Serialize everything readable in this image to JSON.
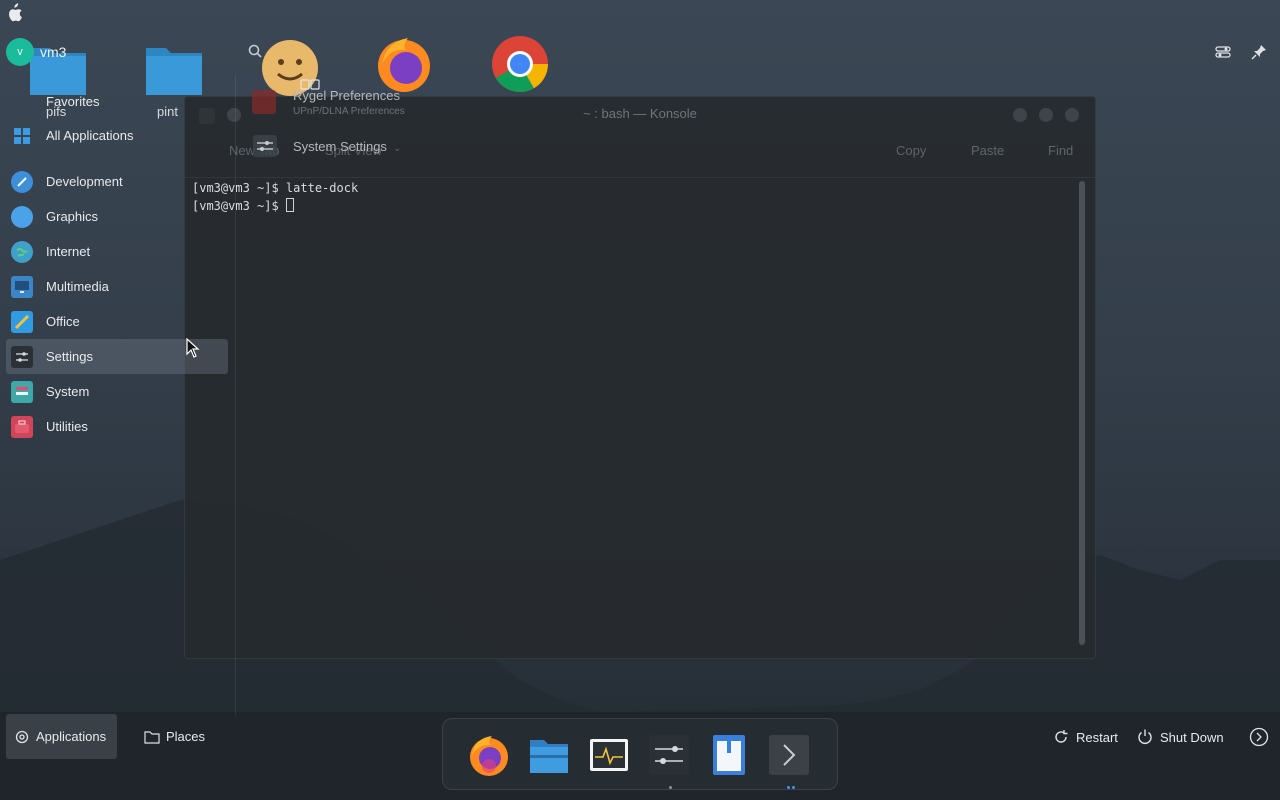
{
  "user": {
    "avatar_letter": "v",
    "name": "vm3"
  },
  "desktop_icons": [
    {
      "label": "pifs",
      "icon": "folder-icon"
    },
    {
      "label": "pint",
      "icon": "folder-icon"
    }
  ],
  "launcher": {
    "favorites_label": "Favorites",
    "all_apps_label": "All Applications",
    "categories": [
      {
        "label": "Development",
        "icon": "development-icon",
        "color": "#3d8fd8"
      },
      {
        "label": "Graphics",
        "icon": "graphics-icon",
        "color": "#4aa3e8"
      },
      {
        "label": "Internet",
        "icon": "internet-icon",
        "color": "#3fa0c9"
      },
      {
        "label": "Multimedia",
        "icon": "multimedia-icon",
        "color": "#3b86c7"
      },
      {
        "label": "Office",
        "icon": "office-icon",
        "color": "#2f9be2"
      },
      {
        "label": "Settings",
        "icon": "settings-icon",
        "color": "#5a636c"
      },
      {
        "label": "System",
        "icon": "system-icon",
        "color": "#3ca9a8"
      },
      {
        "label": "Utilities",
        "icon": "utilities-icon",
        "color": "#d0455a"
      }
    ],
    "active_category": "Settings"
  },
  "overlay": {
    "app1_title": "Rygel Preferences",
    "app1_sub": "UPnP/DLNA Preferences",
    "app2_title": "System Settings"
  },
  "konsole": {
    "title": "~ : bash — Konsole",
    "toolbar": {
      "new_tab": "New Tab",
      "split_view": "Split View",
      "copy": "Copy",
      "paste": "Paste",
      "find": "Find"
    },
    "lines": [
      "[vm3@vm3 ~]$ latte-dock",
      "[vm3@vm3 ~]$ "
    ]
  },
  "bottom": {
    "applications_label": "Applications",
    "places_label": "Places",
    "restart_label": "Restart",
    "shutdown_label": "Shut Down"
  },
  "dock_items": [
    "firefox-icon",
    "dolphin-folder-icon",
    "system-monitor-icon",
    "settings-sliders-icon",
    "text-editor-icon",
    "terminal-icon"
  ]
}
